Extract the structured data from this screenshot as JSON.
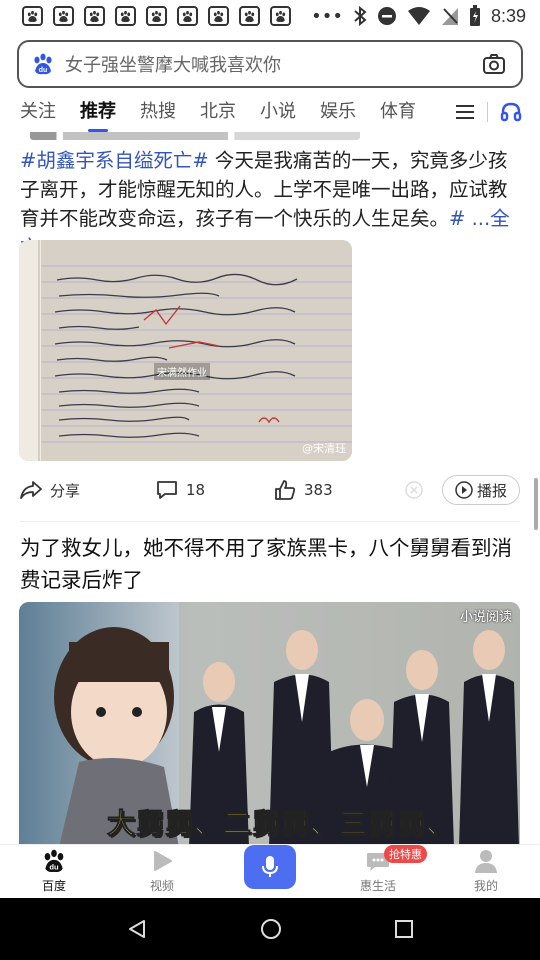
{
  "status_bar": {
    "time": "8:39",
    "notification_count": 9
  },
  "search": {
    "placeholder": "女子强坐警摩大喊我喜欢你"
  },
  "tabs": [
    {
      "label": "关注",
      "active": false
    },
    {
      "label": "推荐",
      "active": true
    },
    {
      "label": "热搜",
      "active": false
    },
    {
      "label": "北京",
      "active": false
    },
    {
      "label": "小说",
      "active": false
    },
    {
      "label": "娱乐",
      "active": false
    },
    {
      "label": "体育",
      "active": false
    }
  ],
  "post1": {
    "hashtag": "#胡鑫宇系自缢死亡#",
    "text": " 今天是我痛苦的一天，究竟多少孩子离开，才能惊醒无知的人。上学不是唯一出路，应试教育并不能改变命运，孩子有一个快乐的人生足矣。",
    "more_hash": "# ",
    "more_link": "...全文",
    "image_watermark": "@宋清珏",
    "image_center_watermark": "宋满然作业",
    "actions": {
      "share": "分享",
      "comments": "18",
      "likes": "383",
      "listen": "播报"
    }
  },
  "post2": {
    "headline": "为了救女儿，她不得不用了家族黑卡，八个舅舅看到消费记录后炸了",
    "image_tag": "小说阅读",
    "image_caption": "大舅舅、二舅舅、三舅舅、"
  },
  "bottom_nav": [
    {
      "label": "百度",
      "icon": "baidu-paw-icon",
      "active": true
    },
    {
      "label": "视频",
      "icon": "play-icon",
      "active": false
    },
    {
      "label": "",
      "icon": "mic-icon",
      "active": false
    },
    {
      "label": "惠生活",
      "icon": "chat-bubble-icon",
      "active": false,
      "badge": "抢特惠"
    },
    {
      "label": "我的",
      "icon": "person-icon",
      "active": false
    }
  ],
  "colors": {
    "accent": "#4e6ef2",
    "hashtag": "#3355bb",
    "badge": "#f04848"
  }
}
